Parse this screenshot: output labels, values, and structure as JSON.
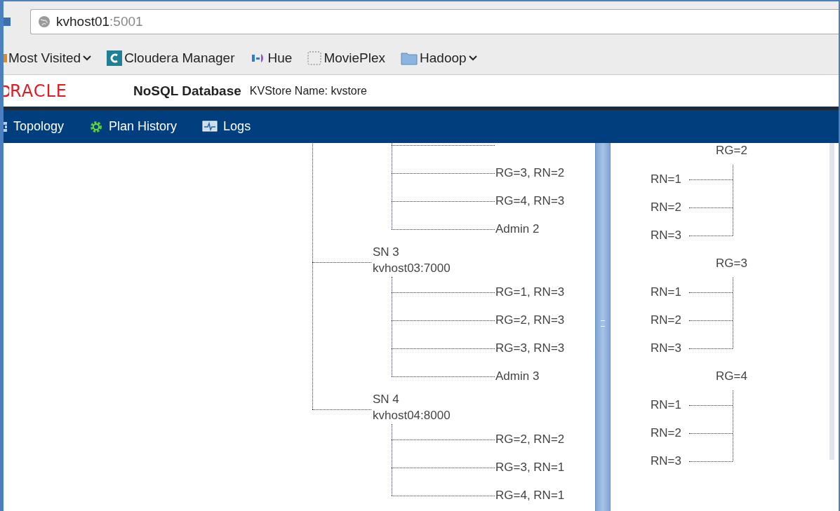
{
  "address_bar": {
    "host": "kvhost01",
    "port": ":5001"
  },
  "bookmarks": [
    {
      "label": "Most Visited",
      "kind": "menu"
    },
    {
      "label": "Cloudera Manager",
      "kind": "cloudera"
    },
    {
      "label": "Hue",
      "kind": "hue"
    },
    {
      "label": "MoviePlex",
      "kind": "page"
    },
    {
      "label": "Hadoop",
      "kind": "folder"
    }
  ],
  "header": {
    "logo": "RACLE",
    "product": "NoSQL Database",
    "store": "KVStore Name: kvstore"
  },
  "nav": [
    {
      "label": "Topology",
      "kind": "topology"
    },
    {
      "label": "Plan History",
      "kind": "plans"
    },
    {
      "label": "Logs",
      "kind": "logs"
    }
  ],
  "storage_nodes": [
    {
      "children": [
        "RG=3, RN=2",
        "RG=4, RN=3",
        "Admin 2"
      ]
    },
    {
      "label": "SN 3",
      "host": "kvhost03:7000",
      "children": [
        "RG=1, RN=3",
        "RG=2, RN=3",
        "RG=3, RN=3",
        "Admin 3"
      ]
    },
    {
      "label": "SN 4",
      "host": "kvhost04:8000",
      "children": [
        "RG=2, RN=2",
        "RG=3, RN=1",
        "RG=4, RN=1"
      ]
    }
  ],
  "replication_groups": [
    {
      "label": "RG=2",
      "children": [
        "RN=1",
        "RN=2",
        "RN=3"
      ]
    },
    {
      "label": "RG=3",
      "children": [
        "RN=1",
        "RN=2",
        "RN=3"
      ]
    },
    {
      "label": "RG=4",
      "children": [
        "RN=1",
        "RN=2",
        "RN=3"
      ]
    }
  ]
}
